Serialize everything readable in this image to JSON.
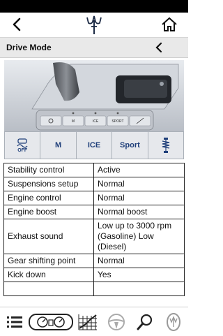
{
  "header": {
    "logo": "trident-logo"
  },
  "section": {
    "title": "Drive Mode"
  },
  "console": {
    "buttons": [
      {
        "icon": "stability-off-icon"
      },
      {
        "label": "M"
      },
      {
        "label": "ICE"
      },
      {
        "label": "SPORT"
      },
      {
        "icon": "suspension-icon"
      }
    ]
  },
  "modes": [
    {
      "icon": "stability-off-icon",
      "label": "OFF"
    },
    {
      "label": "M"
    },
    {
      "label": "ICE"
    },
    {
      "label": "Sport"
    },
    {
      "icon": "suspension-icon"
    }
  ],
  "table": {
    "rows": [
      {
        "key": "Stability control",
        "value": "Active"
      },
      {
        "key": "Suspensions setup",
        "value": "Normal"
      },
      {
        "key": "Engine control",
        "value": "Normal"
      },
      {
        "key": "Engine boost",
        "value": "Normal boost"
      },
      {
        "key": "Exhaust sound",
        "value": "Low up to 3000 rpm (Gasoline) Low (Diesel)"
      },
      {
        "key": "Gear shifting point",
        "value": "Normal"
      },
      {
        "key": "Kick down",
        "value": "Yes"
      }
    ]
  },
  "bottom_nav": [
    {
      "icon": "list-icon"
    },
    {
      "icon": "dashboard-icon"
    },
    {
      "icon": "grid-chart-icon"
    },
    {
      "icon": "steering-wheel-icon"
    },
    {
      "icon": "search-icon"
    },
    {
      "icon": "emblem-icon"
    }
  ]
}
